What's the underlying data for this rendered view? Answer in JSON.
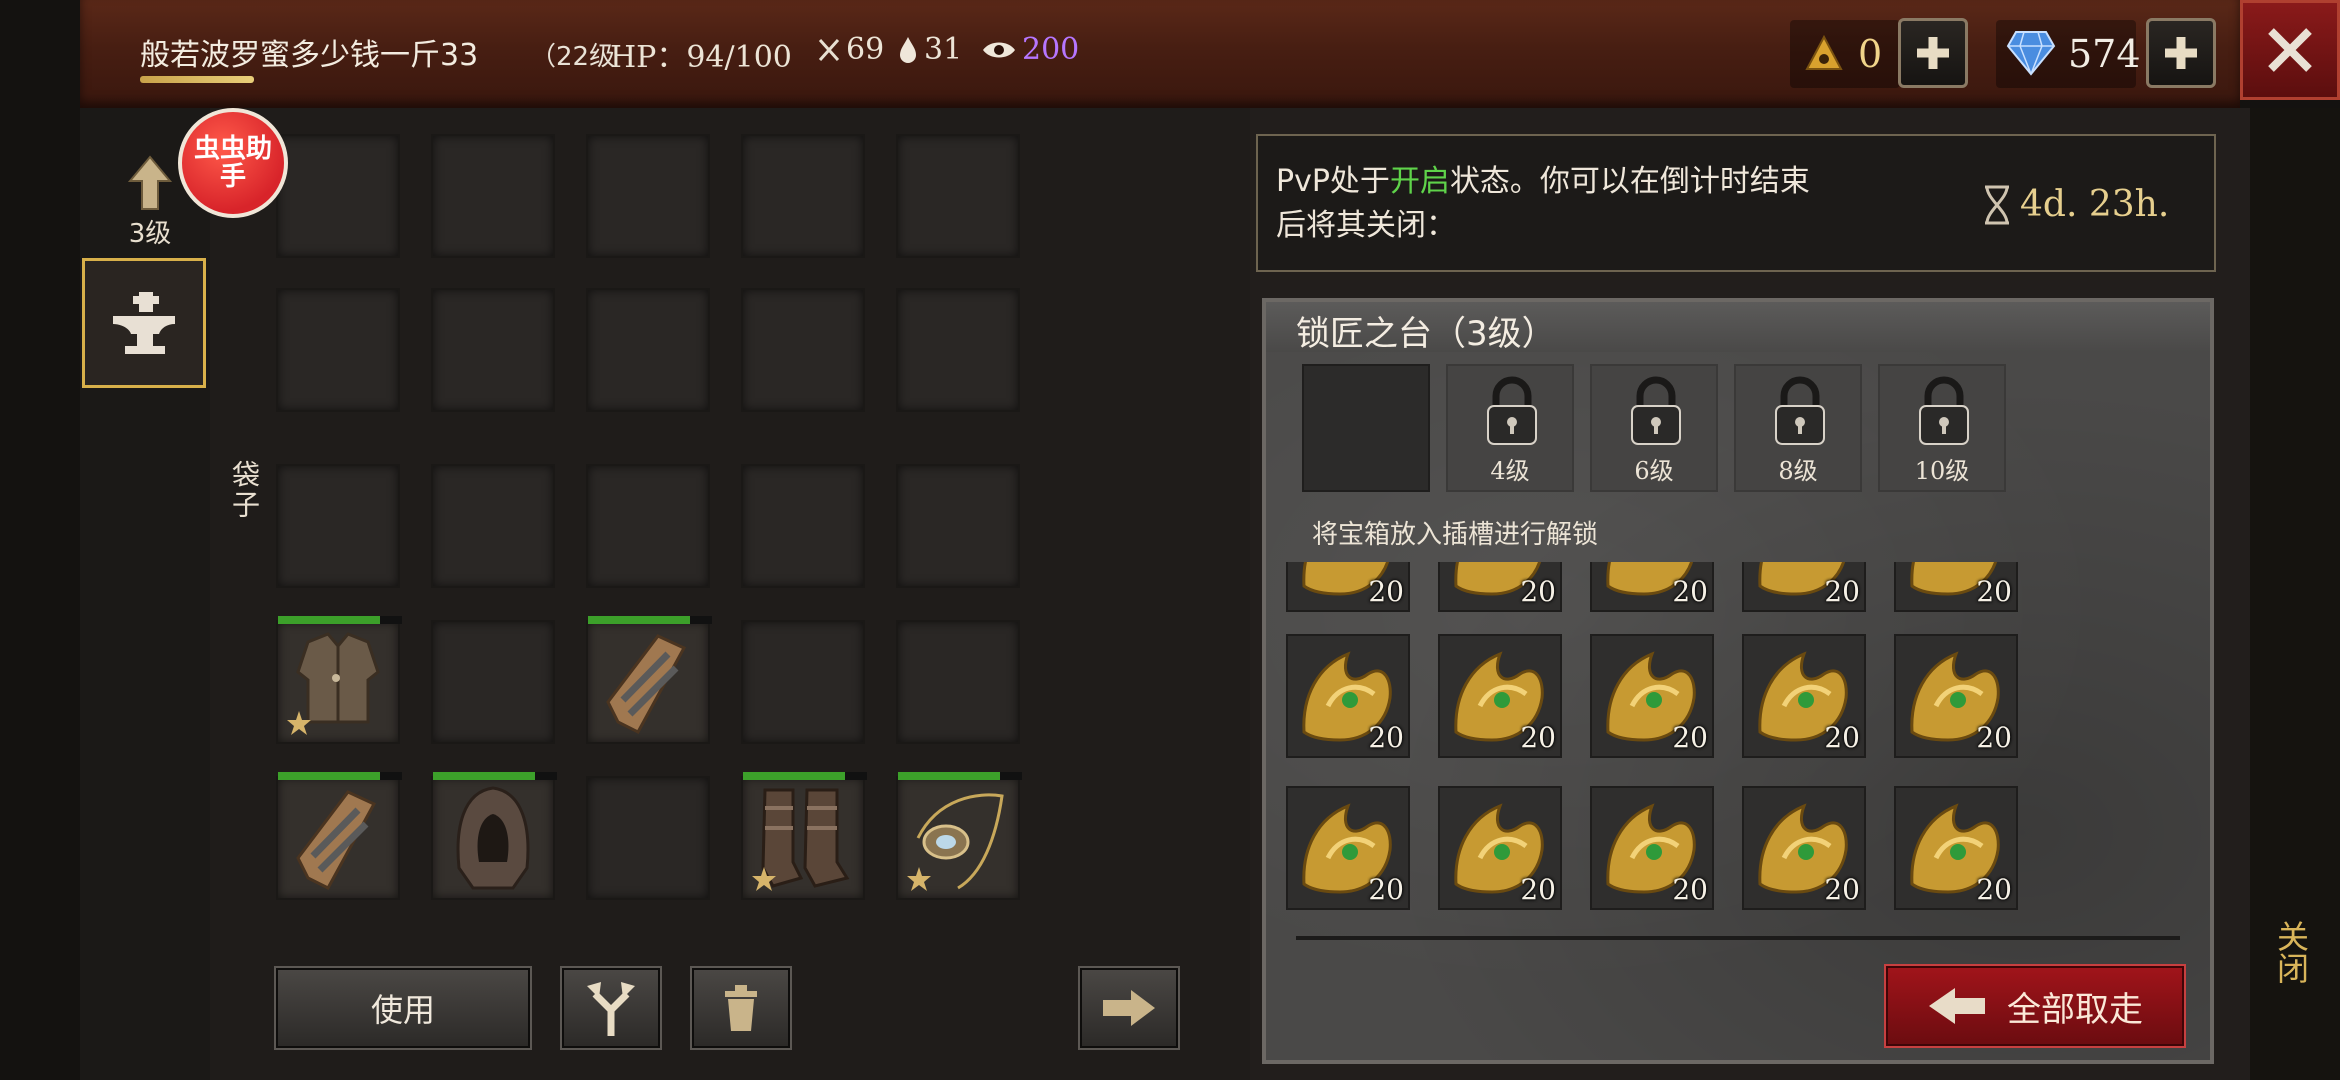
{
  "top_bar": {
    "player_name": "般若波罗蜜多少钱一斤33",
    "level": "（22级",
    "hp": "HP：94/100",
    "attack": "69",
    "water": "31",
    "vision": "200",
    "triangle_currency": "0",
    "gems": "574"
  },
  "sidebar": {
    "upgrade_label": "3级"
  },
  "badge": {
    "text": "虫虫助手"
  },
  "inventory": {
    "bag_label": "袋子",
    "use_button": "使用"
  },
  "pvp": {
    "text_before": "PvP处于",
    "text_on": "开启",
    "text_after": "状态。你可以在倒计时结束后将其关闭：",
    "timer": "4d. 23h."
  },
  "forge": {
    "title": "锁匠之台（3级）",
    "locked_slots": [
      "4级",
      "6级",
      "8级",
      "10级"
    ],
    "hint": "将宝箱放入插槽进行解锁",
    "chest_count": "20",
    "take_all": "全部取走"
  },
  "right_edge": {
    "close_label": "关闭"
  },
  "colors": {
    "accent_gold": "#d8b04a",
    "pvp_on": "#5fd34a",
    "vision": "#b676ff",
    "danger": "#a0141a"
  }
}
